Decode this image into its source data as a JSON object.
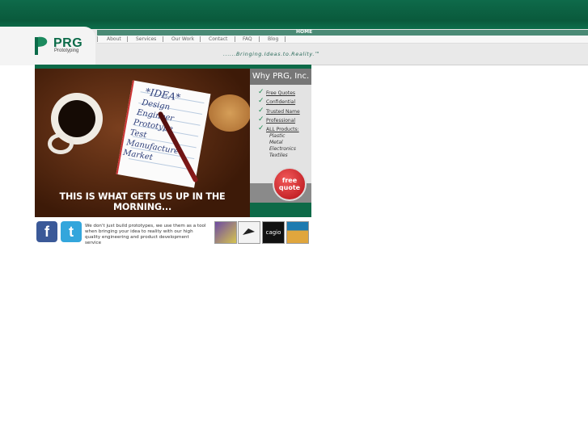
{
  "logo": {
    "name": "PRG",
    "sub": "Prototyping"
  },
  "homebar": {
    "label": "HOME"
  },
  "nav": {
    "items": [
      "About",
      "Services",
      "Our Work",
      "Contact",
      "FAQ",
      "Blog"
    ]
  },
  "tagline": "......Bringing.Ideas.to.Reality.™",
  "hero": {
    "caption": "THIS IS WHAT GETS US UP IN THE MORNING...",
    "pad_words": [
      "*IDEA*",
      "Design",
      "Engineer",
      "Prototype",
      "Test",
      "Manufacture",
      "Market"
    ]
  },
  "why": {
    "title": "Why PRG, Inc.",
    "items": [
      "Free Quotes",
      "Confidential",
      "Trusted Name",
      "Professional",
      "ALL Products:"
    ],
    "sub_items": [
      "Plastic",
      "Metal",
      "Electronics",
      "Textiles"
    ],
    "quote_line1": "free",
    "quote_line2": "quote"
  },
  "social": {
    "facebook": "f",
    "twitter": "t"
  },
  "blurb": "We don't just build prototypes, we use them as a tool when bringing your idea to reality with our high quality engineering and product development service",
  "thumbs": {
    "cagio": "cagio"
  }
}
